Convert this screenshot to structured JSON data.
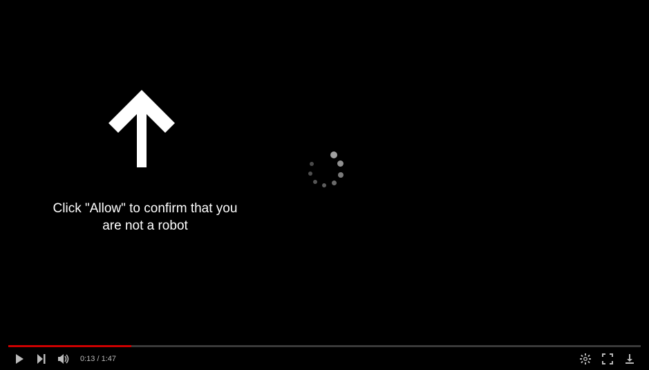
{
  "overlay": {
    "message": "Click \"Allow\" to confirm that you are not a robot"
  },
  "player": {
    "current_time": "0:13",
    "separator": " / ",
    "duration": "1:47",
    "progress_percent": 19.5
  }
}
